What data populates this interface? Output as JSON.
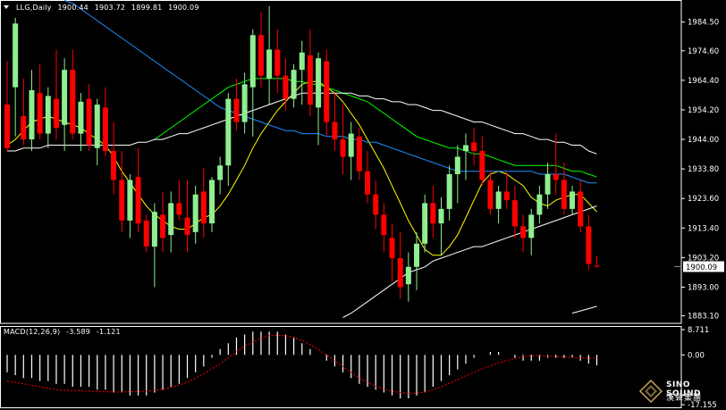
{
  "header": {
    "symbol": "LLG,Daily",
    "open": "1900.44",
    "high": "1903.72",
    "low": "1899.81",
    "close": "1900.09"
  },
  "macd": {
    "label": "MACD(12,26,9)",
    "value": "-3.589",
    "signal": "-1.121",
    "axis_labels": [
      "8.711",
      "0.00",
      "-17.155"
    ]
  },
  "watermark": {
    "text": "SINO SOUND",
    "subtext": "漢聲集團"
  },
  "colors": {
    "background": "#000000",
    "bull": "#90EE90",
    "bear": "#FF0000",
    "ma_fast": "#FFFF00",
    "ma_mid": "#00FF00",
    "ma_slow": "#1E90FF",
    "ma_long": "#FFFFFF",
    "macd_hist": "#FFFFFF",
    "macd_signal": "#FF0000"
  },
  "chart_data": {
    "type": "candlestick",
    "price_axis": {
      "labels": [
        "1984.50",
        "1974.60",
        "1964.40",
        "1954.20",
        "1944.00",
        "1933.80",
        "1923.60",
        "1913.40",
        "1903.20",
        "1893.00",
        "1883.10"
      ],
      "current_price": "1900.09",
      "ylim": [
        1880.5,
        1991.5
      ]
    },
    "candles": [
      [
        1956,
        1971,
        1940,
        1941
      ],
      [
        1962,
        1986,
        1945,
        1984
      ],
      [
        1952,
        1965,
        1942,
        1944
      ],
      [
        1944,
        1968,
        1940,
        1961
      ],
      [
        1960,
        1970,
        1944,
        1946
      ],
      [
        1946,
        1962,
        1941,
        1959
      ],
      [
        1958,
        1975,
        1944,
        1948
      ],
      [
        1949,
        1972,
        1940,
        1968
      ],
      [
        1968,
        1975,
        1944,
        1946
      ],
      [
        1946,
        1960,
        1940,
        1957
      ],
      [
        1958,
        1963,
        1940,
        1942
      ],
      [
        1941,
        1958,
        1935,
        1956
      ],
      [
        1955,
        1962,
        1938,
        1940
      ],
      [
        1940,
        1950,
        1925,
        1930
      ],
      [
        1930,
        1940,
        1912,
        1916
      ],
      [
        1916,
        1932,
        1910,
        1930
      ],
      [
        1931,
        1941,
        1912,
        1915
      ],
      [
        1916,
        1918,
        1905,
        1907
      ],
      [
        1907,
        1922,
        1893,
        1919
      ],
      [
        1918,
        1926,
        1905,
        1910
      ],
      [
        1911,
        1926,
        1905,
        1922
      ],
      [
        1922,
        1930,
        1916,
        1918
      ],
      [
        1917,
        1930,
        1905,
        1911
      ],
      [
        1912,
        1928,
        1908,
        1925
      ],
      [
        1926,
        1934,
        1910,
        1915
      ],
      [
        1915,
        1931,
        1912,
        1930
      ],
      [
        1930,
        1938,
        1925,
        1935
      ],
      [
        1935,
        1960,
        1928,
        1958
      ],
      [
        1958,
        1965,
        1947,
        1950
      ],
      [
        1950,
        1967,
        1946,
        1963
      ],
      [
        1962,
        1982,
        1945,
        1980
      ],
      [
        1980,
        1988,
        1962,
        1966
      ],
      [
        1965,
        1990,
        1956,
        1975
      ],
      [
        1975,
        1982,
        1960,
        1966
      ],
      [
        1966,
        1972,
        1954,
        1958
      ],
      [
        1958,
        1970,
        1955,
        1968
      ],
      [
        1968,
        1978,
        1956,
        1974
      ],
      [
        1973,
        1982,
        1952,
        1956
      ],
      [
        1955,
        1974,
        1942,
        1972
      ],
      [
        1971,
        1975,
        1945,
        1950
      ],
      [
        1950,
        1960,
        1940,
        1944
      ],
      [
        1944,
        1956,
        1932,
        1938
      ],
      [
        1938,
        1950,
        1930,
        1946
      ],
      [
        1945,
        1948,
        1930,
        1933
      ],
      [
        1933,
        1940,
        1922,
        1925
      ],
      [
        1925,
        1930,
        1913,
        1918
      ],
      [
        1918,
        1922,
        1905,
        1911
      ],
      [
        1910,
        1915,
        1895,
        1903
      ],
      [
        1903,
        1912,
        1889,
        1893
      ],
      [
        1894,
        1905,
        1888,
        1900
      ],
      [
        1900,
        1912,
        1892,
        1908
      ],
      [
        1908,
        1925,
        1905,
        1922
      ],
      [
        1922,
        1928,
        1910,
        1915
      ],
      [
        1915,
        1924,
        1904,
        1920
      ],
      [
        1920,
        1935,
        1916,
        1932
      ],
      [
        1932,
        1942,
        1922,
        1938
      ],
      [
        1940,
        1946,
        1930,
        1942
      ],
      [
        1943,
        1948,
        1935,
        1940
      ],
      [
        1940,
        1945,
        1928,
        1930
      ],
      [
        1930,
        1933,
        1918,
        1920
      ],
      [
        1920,
        1928,
        1915,
        1926
      ],
      [
        1926,
        1933,
        1920,
        1923
      ],
      [
        1923,
        1928,
        1910,
        1914
      ],
      [
        1914,
        1918,
        1905,
        1910
      ],
      [
        1910,
        1920,
        1904,
        1918
      ],
      [
        1918,
        1928,
        1915,
        1925
      ],
      [
        1925,
        1936,
        1920,
        1932
      ],
      [
        1932,
        1946,
        1925,
        1930
      ],
      [
        1930,
        1936,
        1918,
        1920
      ],
      [
        1920,
        1928,
        1918,
        1926
      ],
      [
        1926,
        1930,
        1912,
        1914
      ],
      [
        1914,
        1918,
        1899,
        1901
      ],
      [
        1900.44,
        1903.72,
        1899.81,
        1900.09
      ]
    ],
    "moving_averages": [
      {
        "name": "ma_fast",
        "color": "#FFFF00",
        "values": [
          1942,
          1944,
          1947,
          1950,
          1951,
          1952,
          1951,
          1950,
          1949,
          1948,
          1946,
          1944,
          1942,
          1938,
          1933,
          1929,
          1925,
          1921,
          1918,
          1916,
          1914,
          1913,
          1913,
          1915,
          1917,
          1918,
          1921,
          1925,
          1930,
          1935,
          1941,
          1946,
          1950,
          1954,
          1957,
          1960,
          1963,
          1964,
          1964,
          1962,
          1960,
          1957,
          1953,
          1949,
          1944,
          1939,
          1934,
          1928,
          1922,
          1916,
          1911,
          1906,
          1904,
          1904,
          1907,
          1911,
          1917,
          1923,
          1929,
          1932,
          1933,
          1932,
          1930,
          1928,
          1924,
          1922,
          1921,
          1923,
          1924,
          1925,
          1925,
          1922,
          1919
        ]
      },
      {
        "name": "ma_mid",
        "color": "#00FF00",
        "values": [
          null,
          null,
          null,
          null,
          null,
          null,
          null,
          null,
          null,
          null,
          null,
          null,
          null,
          null,
          null,
          null,
          null,
          null,
          1944,
          1946,
          1948,
          1950,
          1952,
          1954,
          1956,
          1958,
          1960,
          1962,
          1963,
          1964,
          1965,
          1965,
          1965,
          1965,
          1965,
          1964,
          1964,
          1963,
          1963,
          1962,
          1961,
          1960,
          1959,
          1958,
          1957,
          1955,
          1953,
          1951,
          1949,
          1947,
          1945,
          1944,
          1943,
          1942,
          1941,
          1941,
          1940,
          1939,
          1939,
          1938,
          1937,
          1936,
          1935,
          1935,
          1935,
          1935,
          1935,
          1935,
          1934,
          1933,
          1933,
          1932,
          1931
        ]
      },
      {
        "name": "ma_slow",
        "color": "#1E90FF",
        "values": [
          null,
          null,
          null,
          null,
          null,
          null,
          null,
          1992,
          1991,
          1989,
          1987,
          1985,
          1983,
          1981,
          1979,
          1977,
          1975,
          1973,
          1971,
          1969,
          1967,
          1965,
          1963,
          1961,
          1959,
          1957,
          1955,
          1954,
          1953,
          1952,
          1951,
          1950,
          1949,
          1948,
          1947,
          1947,
          1946,
          1946,
          1946,
          1945,
          1945,
          1945,
          1944,
          1944,
          1943,
          1943,
          1942,
          1941,
          1940,
          1939,
          1938,
          1937,
          1936,
          1935,
          1934,
          1933,
          1933,
          1933,
          1933,
          1933,
          1933,
          1933,
          1933,
          1933,
          1933,
          1932,
          1932,
          1932,
          1932,
          1931,
          1930,
          1929,
          1929
        ]
      },
      {
        "name": "ma_long",
        "color": "#FFFFFF",
        "values": [
          1940,
          1940,
          1941,
          1941,
          1941,
          1942,
          1942,
          1942,
          1942,
          1942,
          1942,
          1942,
          1942,
          1942,
          1942,
          1942,
          1943,
          1943,
          1944,
          1944,
          1945,
          1946,
          1946,
          1947,
          1948,
          1949,
          1950,
          1951,
          1952,
          1953,
          1954,
          1955,
          1956,
          1957,
          1958,
          1959,
          1960,
          1960,
          1960,
          1960,
          1960,
          1960,
          1960,
          1959,
          1959,
          1958,
          1958,
          1957,
          1957,
          1956,
          1956,
          1955,
          1954,
          1954,
          1953,
          1952,
          1951,
          1950,
          1950,
          1949,
          1948,
          1947,
          1946,
          1946,
          1945,
          1944,
          1944,
          1943,
          1943,
          1942,
          1942,
          1940,
          1939
        ]
      },
      {
        "name": "ma_extra",
        "color": "#FFFFFF",
        "values": [
          null,
          null,
          null,
          null,
          null,
          null,
          null,
          null,
          null,
          null,
          null,
          null,
          null,
          null,
          null,
          null,
          null,
          null,
          null,
          null,
          null,
          null,
          null,
          null,
          null,
          null,
          null,
          null,
          null,
          null,
          null,
          null,
          null,
          null,
          null,
          null,
          null,
          null,
          null,
          null,
          null,
          1882.5,
          1884,
          1886,
          1888,
          1890,
          1892,
          1894,
          1896,
          1898,
          1899,
          1900,
          1902,
          1903,
          1904,
          1905,
          1906,
          1907,
          1907,
          1908,
          1909,
          1910,
          1911,
          1912,
          1913,
          1914,
          1915,
          1916,
          1917,
          1918,
          1919,
          1920,
          1921
        ]
      },
      {
        "name": "ma_bottom",
        "color": "#FFFFFF",
        "values": [
          null,
          null,
          null,
          null,
          null,
          null,
          null,
          null,
          null,
          null,
          null,
          null,
          null,
          null,
          null,
          null,
          null,
          null,
          null,
          null,
          null,
          null,
          null,
          null,
          null,
          null,
          null,
          null,
          null,
          null,
          null,
          null,
          null,
          null,
          null,
          null,
          null,
          null,
          null,
          null,
          null,
          null,
          null,
          null,
          null,
          null,
          null,
          null,
          null,
          null,
          null,
          null,
          null,
          null,
          null,
          null,
          null,
          null,
          null,
          null,
          null,
          null,
          null,
          null,
          null,
          null,
          null,
          null,
          null,
          1884,
          1884.8,
          1885.6,
          1886.4
        ]
      }
    ],
    "macd_histogram": [
      -6,
      -7,
      -8,
      -8,
      -9,
      -9,
      -10,
      -10,
      -11,
      -11,
      -11,
      -12,
      -12,
      -13,
      -13,
      -14,
      -14,
      -14,
      -13,
      -12,
      -11,
      -10,
      -8,
      -6,
      -4,
      -1,
      2,
      4,
      6,
      7,
      8,
      8,
      8,
      8,
      7,
      6,
      4,
      2,
      0,
      -2,
      -4,
      -6,
      -8,
      -10,
      -11,
      -12,
      -13,
      -14,
      -15,
      -15,
      -14,
      -13,
      -11,
      -9,
      -7,
      -5,
      -3,
      -1,
      0,
      1,
      1,
      0,
      -1,
      -2,
      -2,
      -2,
      -1,
      -1,
      -1,
      -1,
      -2,
      -3,
      -3.589
    ],
    "macd_signal": [
      -9,
      -9.5,
      -10,
      -10.5,
      -11,
      -11.5,
      -12,
      -12.2,
      -12.3,
      -12.4,
      -12.5,
      -12.6,
      -12.7,
      -12.8,
      -12.8,
      -12.7,
      -12.6,
      -12.5,
      -12.2,
      -11.8,
      -11.2,
      -10.4,
      -9.4,
      -8,
      -6.5,
      -4.8,
      -3,
      -1,
      1,
      3,
      4.5,
      5.8,
      6.6,
      6.8,
      6.6,
      6,
      5,
      3.5,
      1.8,
      0,
      -2,
      -4,
      -6,
      -8,
      -9.5,
      -10.8,
      -11.8,
      -12.5,
      -13,
      -13.3,
      -13.2,
      -12.8,
      -12,
      -11,
      -9.8,
      -8.5,
      -7.2,
      -6,
      -4.8,
      -3.8,
      -2.8,
      -2,
      -1.2,
      -0.6,
      -0.3,
      -0.2,
      -0.4,
      -0.6,
      -0.8,
      -0.9,
      -1,
      -1.1,
      -1.121
    ],
    "macd_ylim": [
      -17.155,
      8.711
    ]
  }
}
